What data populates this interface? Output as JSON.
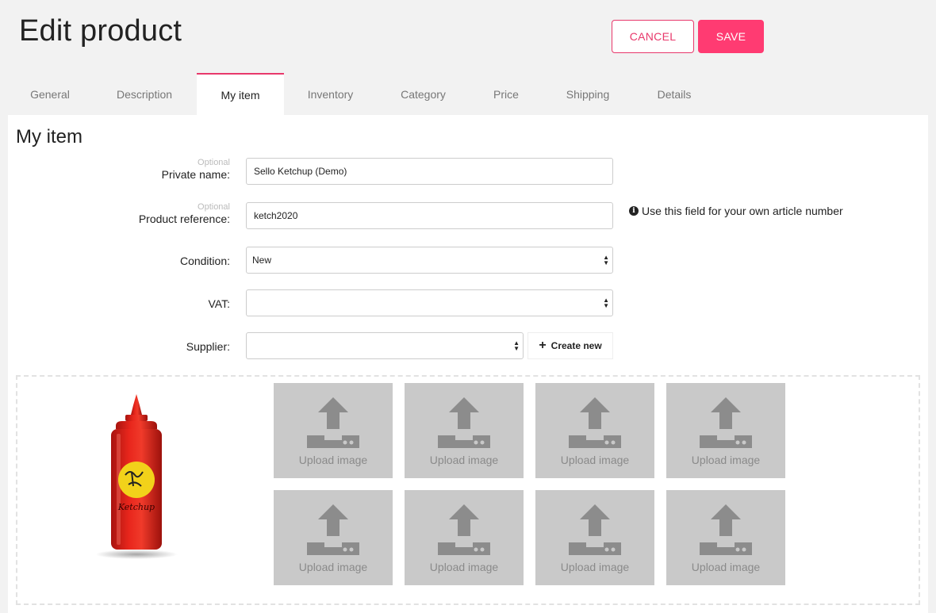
{
  "header": {
    "title": "Edit product",
    "cancel_label": "CANCEL",
    "save_label": "SAVE"
  },
  "tabs": [
    {
      "label": "General"
    },
    {
      "label": "Description"
    },
    {
      "label": "My item"
    },
    {
      "label": "Inventory"
    },
    {
      "label": "Category"
    },
    {
      "label": "Price"
    },
    {
      "label": "Shipping"
    },
    {
      "label": "Details"
    }
  ],
  "active_tab": "My item",
  "section": {
    "title": "My item"
  },
  "form": {
    "private_name": {
      "optional": "Optional",
      "label": "Private name:",
      "value": "Sello Ketchup (Demo)"
    },
    "product_reference": {
      "optional": "Optional",
      "label": "Product reference:",
      "value": "ketch2020",
      "hint": "Use this field for your own article number"
    },
    "condition": {
      "label": "Condition:",
      "value": "New"
    },
    "vat": {
      "label": "VAT:",
      "value": ""
    },
    "supplier": {
      "label": "Supplier:",
      "value": "",
      "create_label": "Create new"
    }
  },
  "images": {
    "product_image": {
      "icon": "ketchup-bottle-image",
      "label_text": "Ketchup"
    },
    "upload_label": "Upload image",
    "upload_slots": 8
  },
  "colors": {
    "accent": "#ff3b72",
    "accent_border": "#e8386b",
    "tile": "#c9c9c9",
    "tile_icon": "#8c8c8c"
  }
}
